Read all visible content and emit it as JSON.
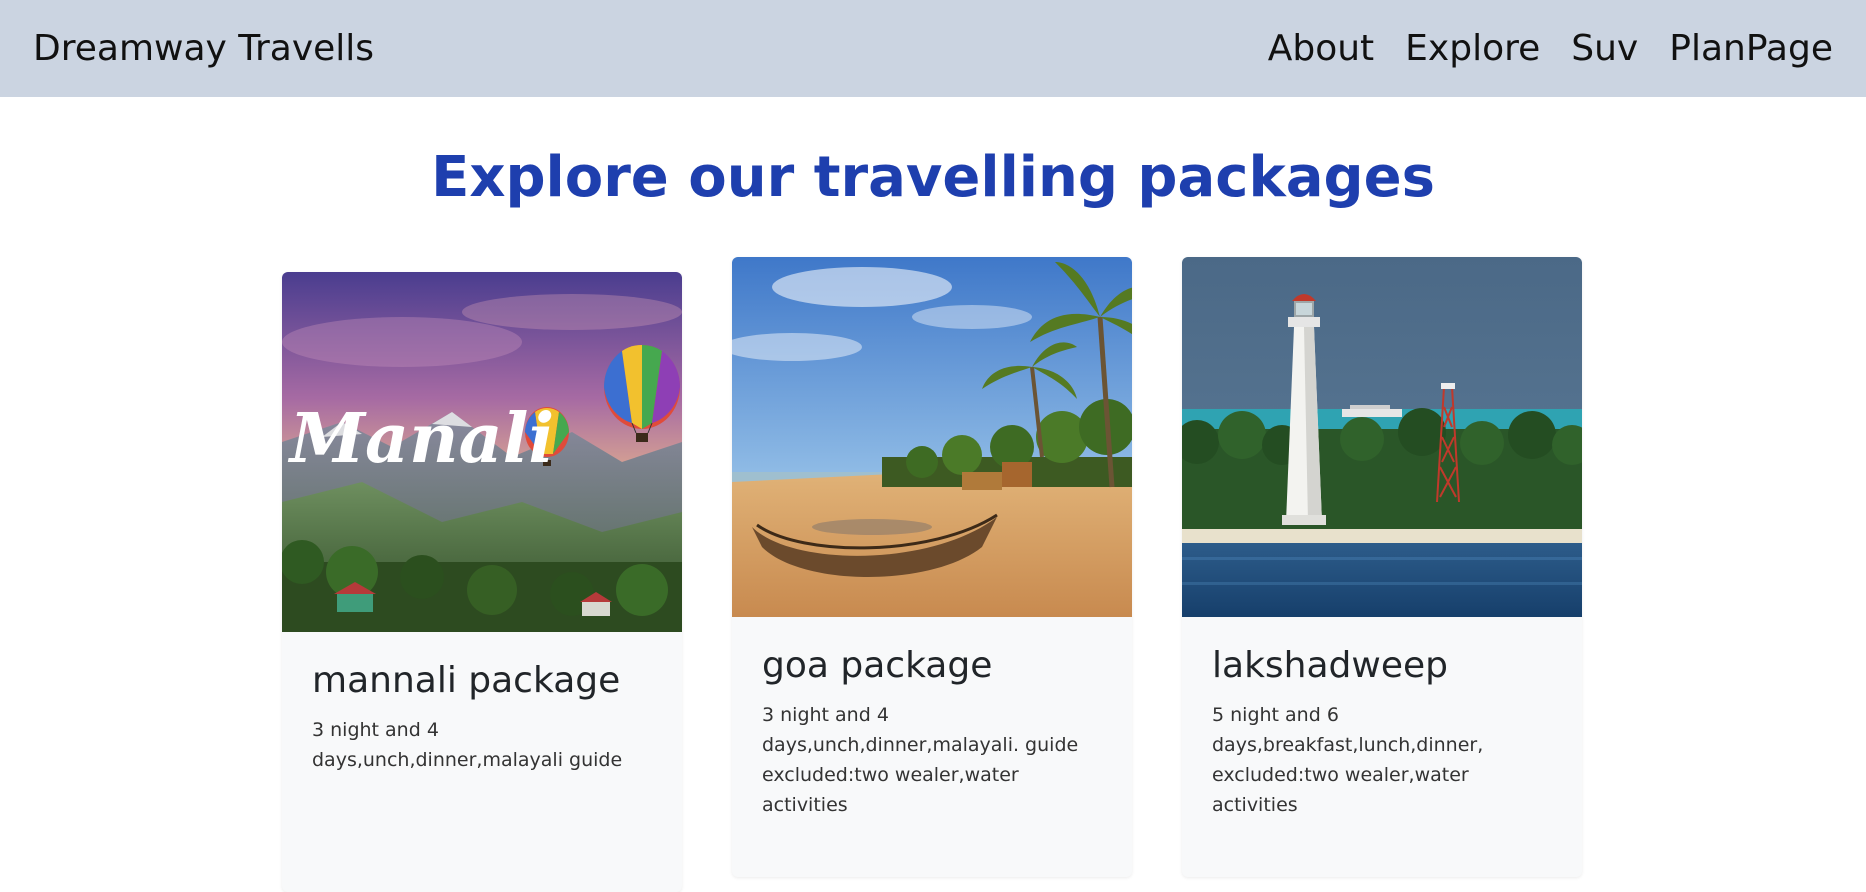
{
  "navbar": {
    "brand": "Dreamway Travells",
    "links": [
      "About",
      "Explore",
      "Suv",
      "PlanPage"
    ]
  },
  "page": {
    "heading": "Explore our travelling packages"
  },
  "cards": [
    {
      "title": "mannali package",
      "text": "3 night and 4\ndays,unch,dinner,malayali guide",
      "image_label": "Manali"
    },
    {
      "title": "goa package",
      "text": "3 night and 4\ndays,unch,dinner,malayali. guide\nexcluded:two wealer,water activities"
    },
    {
      "title": "lakshadweep",
      "text": "5 night and 6\ndays,breakfast,lunch,dinner,\nexcluded:two wealer,water activities"
    }
  ],
  "colors": {
    "navbar_bg": "#cbd4e1",
    "heading": "#1e3fae",
    "card_bg": "#f8f9fa"
  }
}
